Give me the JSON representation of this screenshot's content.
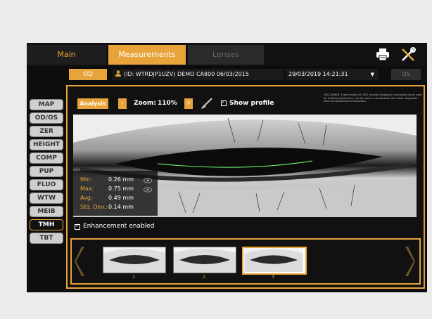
{
  "topbar": {
    "tabs": [
      {
        "label": "Main"
      },
      {
        "label": "Measurements"
      },
      {
        "label": "Lenses"
      }
    ]
  },
  "patient_bar": {
    "od_label": "OD",
    "patient": "(ID: WTRDJP1UZV) DEMO CA800 06/03/2015",
    "date": "29/03/2019 14:21:31",
    "os_label": "OS"
  },
  "sidebar": {
    "items": [
      {
        "label": "MAP"
      },
      {
        "label": "OD/OS"
      },
      {
        "label": "ZER"
      },
      {
        "label": "HEIGHT"
      },
      {
        "label": "COMP"
      },
      {
        "label": "PUP"
      },
      {
        "label": "FLUO"
      },
      {
        "label": "WTW"
      },
      {
        "label": "MEIB"
      },
      {
        "label": "TMH"
      },
      {
        "label": "TBT"
      }
    ],
    "active": "TMH"
  },
  "toolbar": {
    "analysis_label": "Analysis",
    "minus_label": "-",
    "zoom_label": "Zoom:",
    "zoom_value": "110%",
    "plus_label": "+",
    "show_profile_label": "Show profile",
    "disclaimer": "DISCLAIMER: These results DO NOT provide Diagnostic indications to be used for defining treatments. Can be used in combination with other diagnostic tests and professional evaluation."
  },
  "stats": {
    "min": {
      "label": "Min:",
      "value": "0.26 mm"
    },
    "max": {
      "label": "Max:",
      "value": "0.75 mm"
    },
    "avg": {
      "label": "Avg:",
      "value": "0.49 mm"
    },
    "std": {
      "label": "Std. Dev.:",
      "value": "0.14 mm"
    }
  },
  "enhancement_label": "Enhancement enabled",
  "thumbnails": [
    {
      "label": "1"
    },
    {
      "label": "2"
    },
    {
      "label": "3"
    }
  ],
  "colors": {
    "accent": "#e8a33a",
    "profile_line": "#66dd66"
  }
}
